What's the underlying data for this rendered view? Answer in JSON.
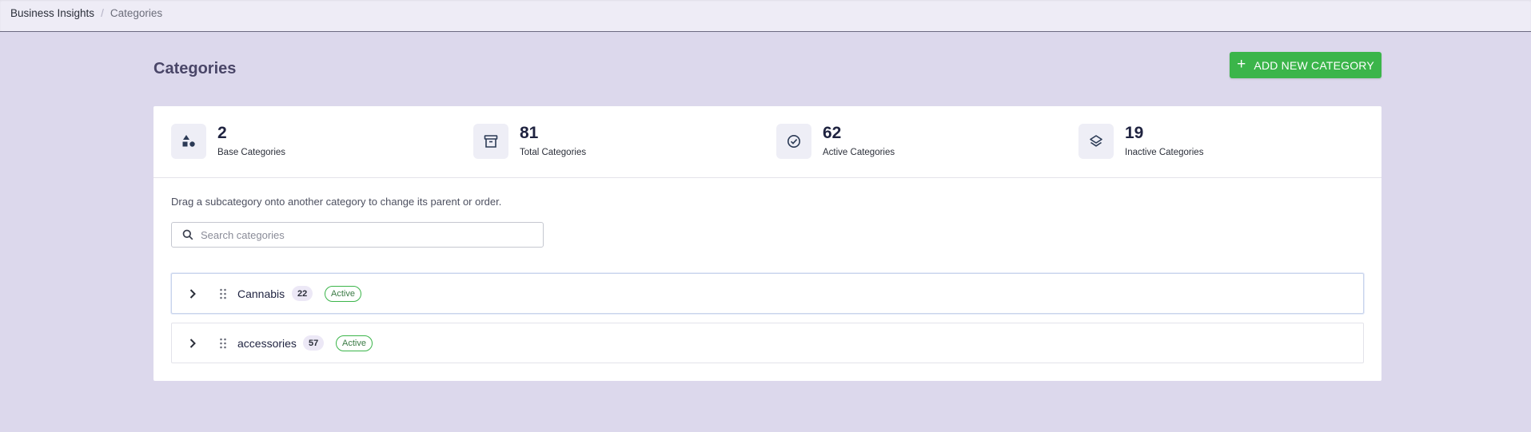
{
  "breadcrumb": {
    "root": "Business Insights",
    "separator": "/",
    "current": "Categories"
  },
  "page": {
    "title": "Categories",
    "add_button": "ADD NEW CATEGORY",
    "add_icon": "plus-icon"
  },
  "stats": [
    {
      "value": "2",
      "label": "Base Categories",
      "icon": "shapes-icon"
    },
    {
      "value": "81",
      "label": "Total Categories",
      "icon": "archive-icon"
    },
    {
      "value": "62",
      "label": "Active Categories",
      "icon": "check-circle-icon"
    },
    {
      "value": "19",
      "label": "Inactive Categories",
      "icon": "layers-icon"
    }
  ],
  "hint": "Drag a subcategory onto another category to change its parent or order.",
  "search": {
    "placeholder": "Search categories",
    "value": ""
  },
  "categories": [
    {
      "name": "Cannabis",
      "count": "22",
      "status": "Active"
    },
    {
      "name": "accessories",
      "count": "57",
      "status": "Active"
    }
  ],
  "colors": {
    "accent": "#3bb54a",
    "background": "#dcd8ec",
    "title": "#4a4668",
    "icon": "#2b3a55"
  }
}
